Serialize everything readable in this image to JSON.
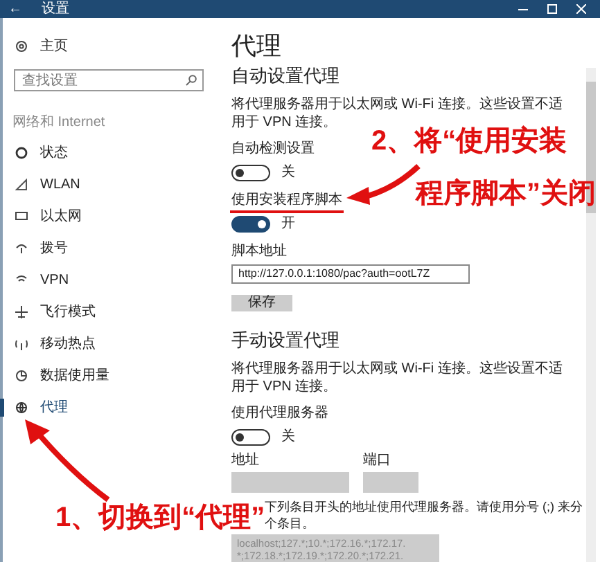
{
  "window": {
    "title": "设置",
    "back": "←"
  },
  "sidebar": {
    "home": "主页",
    "search": {
      "placeholder": "查找设置"
    },
    "section": "网络和 Internet",
    "items": [
      {
        "label": "状态",
        "selected": false
      },
      {
        "label": "WLAN",
        "selected": false
      },
      {
        "label": "以太网",
        "selected": false
      },
      {
        "label": "拨号",
        "selected": false
      },
      {
        "label": "VPN",
        "selected": false
      },
      {
        "label": "飞行模式",
        "selected": false
      },
      {
        "label": "移动热点",
        "selected": false
      },
      {
        "label": "数据使用量",
        "selected": false
      },
      {
        "label": "代理",
        "selected": true
      }
    ]
  },
  "page": {
    "title": "代理",
    "auto": {
      "heading": "自动设置代理",
      "description": "将代理服务器用于以太网或 Wi-Fi 连接。这些设置不适用于 VPN 连接。",
      "toggles": [
        {
          "label": "自动检测设置",
          "on": false,
          "state": "关"
        },
        {
          "label": "使用安装程序脚本",
          "on": true,
          "state": "开"
        }
      ],
      "script_label": "脚本地址",
      "script_value": "http://127.0.0.1:1080/pac?auth=ootL7Z",
      "save": "保存"
    },
    "manual": {
      "heading": "手动设置代理",
      "description": "将代理服务器用于以太网或 Wi-Fi 连接。这些设置不适用于 VPN 连接。",
      "toggle": {
        "label": "使用代理服务器",
        "on": false,
        "state": "关"
      },
      "address_label": "地址",
      "port_label": "端口",
      "exceptions_line1": "下列条目开头的地址使用代理服务器。请使用分号 (;) 来分",
      "exceptions_line2": "个条目。",
      "exceptions_lines": [
        "localhost;127.*;10.*;172.16.*;172.17.",
        "*;172.18.*;172.19.*;172.20.*;172.21."
      ]
    }
  },
  "annotations": [
    {
      "lines": [
        "1、切换到“代理”"
      ]
    },
    {
      "lines": [
        "2、将“使用安装",
        "程序脚本”关闭"
      ]
    }
  ]
}
